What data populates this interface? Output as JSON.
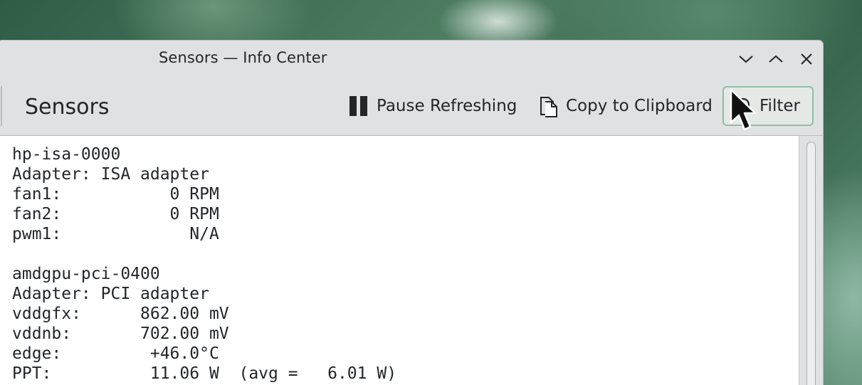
{
  "window": {
    "title": "Sensors — Info Center"
  },
  "header": {
    "page_title": "Sensors",
    "pause_label": "Pause Refreshing",
    "copy_label": "Copy to Clipboard",
    "filter_label": "Filter"
  },
  "icons": {
    "minimize": "chevron-down-icon",
    "maximize": "chevron-up-icon",
    "close": "close-icon",
    "pause": "pause-icon",
    "copy": "copy-icon",
    "filter": "search-icon",
    "cursor": "mouse-pointer-icon"
  },
  "sensors_output": [
    "hp-isa-0000",
    "Adapter: ISA adapter",
    "fan1:           0 RPM",
    "fan2:           0 RPM",
    "pwm1:             N/A",
    "",
    "amdgpu-pci-0400",
    "Adapter: PCI adapter",
    "vddgfx:      862.00 mV",
    "vddnb:       702.00 mV",
    "edge:         +46.0°C",
    "PPT:          11.06 W  (avg =   6.01 W)"
  ],
  "colors": {
    "accent": "#8fbfa5",
    "text": "#232629",
    "window_bg": "#dfe1e3"
  }
}
